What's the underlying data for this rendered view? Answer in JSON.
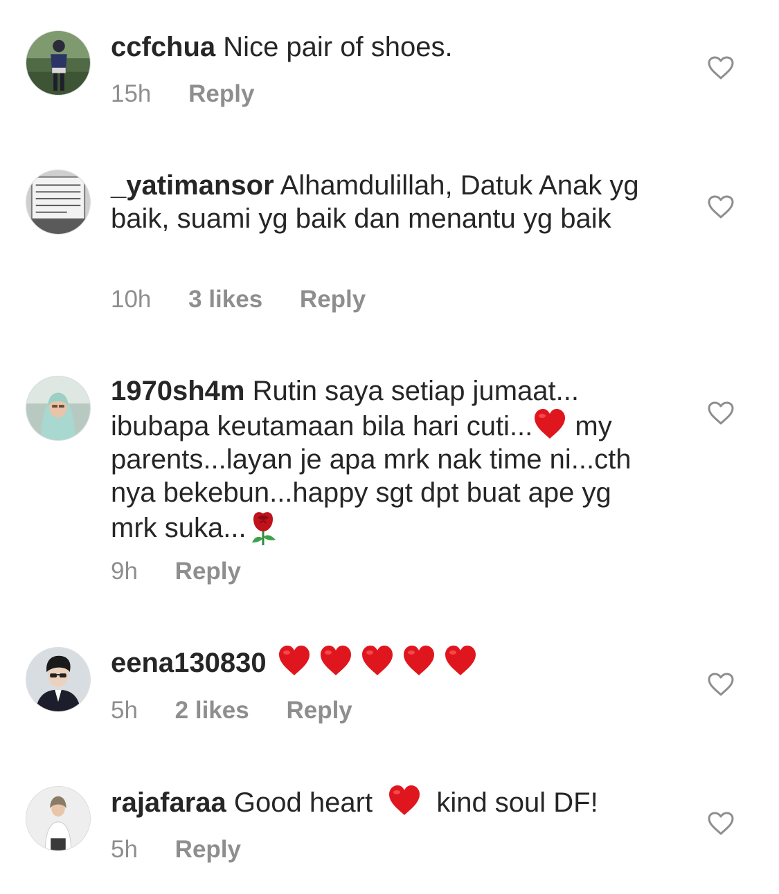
{
  "comments": [
    {
      "username": "ccfchua",
      "text": "Nice pair of shoes.",
      "time": "15h",
      "likes": "",
      "reply_label": "Reply",
      "avatar_icon": "profile-photo-woman-garden"
    },
    {
      "username": "_yatimansor",
      "text": "Alhamdulillah, Datuk Anak yg baik, suami yg baik dan menantu yg baik",
      "time": "10h",
      "likes": "3 likes",
      "reply_label": "Reply",
      "avatar_icon": "profile-photo-calligraphy"
    },
    {
      "username": "1970sh4m",
      "text_parts": [
        "Rutin saya setiap jumaat... ibubapa keutamaan bila hari cuti...",
        " my parents...layan je apa mrk nak time ni...cth nya bekebun...happy sgt dpt buat ape yg mrk suka..."
      ],
      "time": "9h",
      "likes": "",
      "reply_label": "Reply",
      "avatar_icon": "profile-photo-woman-hijab"
    },
    {
      "username": "eena130830",
      "text": "",
      "time": "5h",
      "likes": "2 likes",
      "reply_label": "Reply",
      "avatar_icon": "profile-photo-man-suit"
    },
    {
      "username": "rajafaraa",
      "text_parts": [
        "Good heart",
        "kind soul DF!"
      ],
      "time": "5h",
      "likes": "",
      "reply_label": "Reply",
      "avatar_icon": "profile-photo-woman-white"
    }
  ],
  "icons": {
    "like": "heart-outline-icon",
    "emoji_heart": "red-heart-emoji",
    "emoji_rose": "rose-emoji"
  },
  "colors": {
    "text": "#262626",
    "meta": "#8e8e8e",
    "emoji_red": "#e0161f",
    "heart_outline": "#8e8e8e"
  }
}
